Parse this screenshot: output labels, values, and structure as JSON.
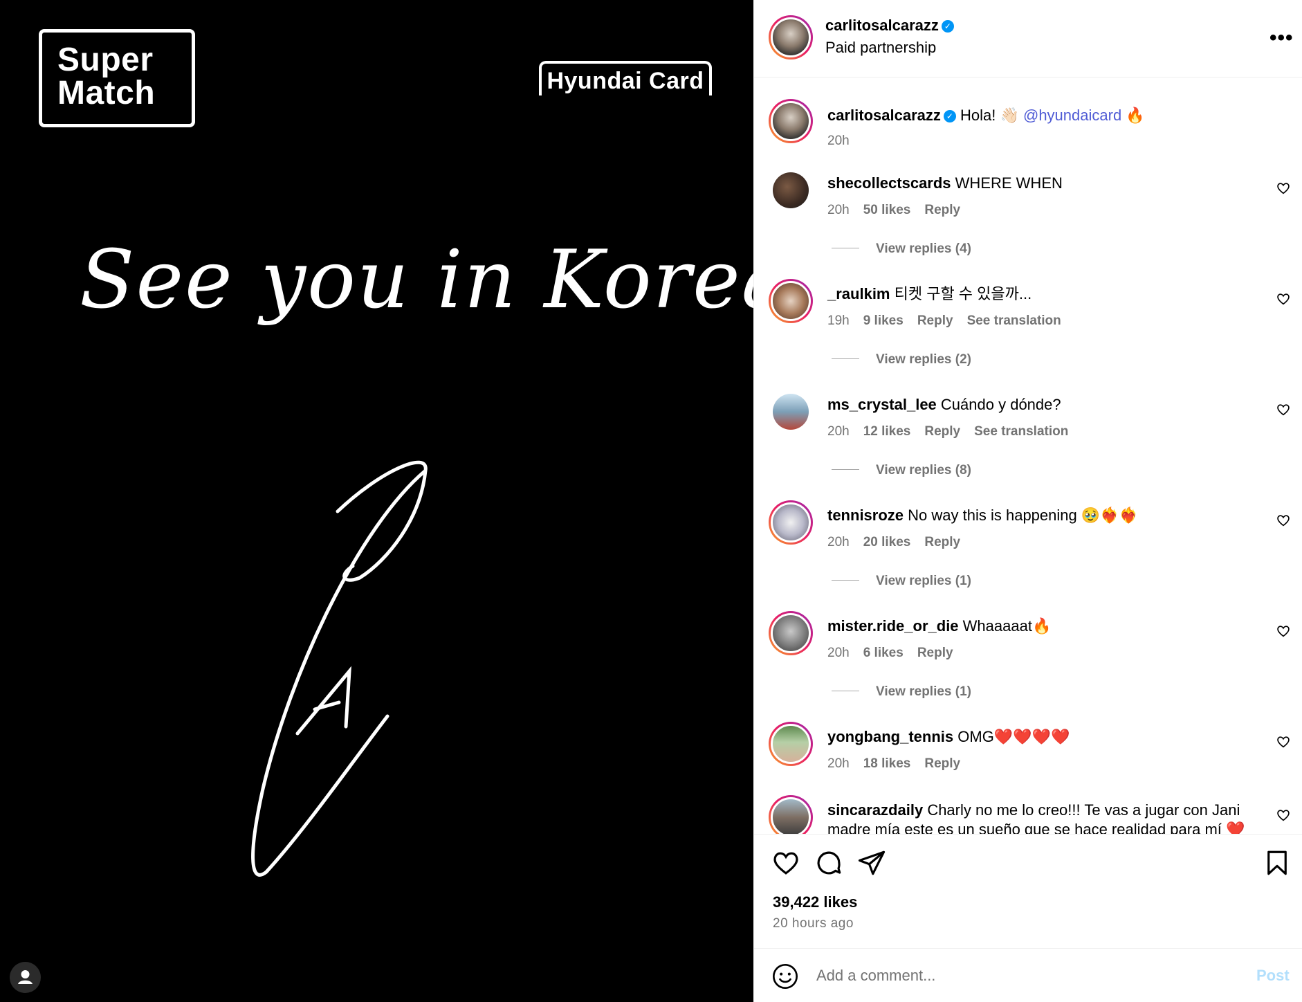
{
  "media": {
    "logo_line1": "Super",
    "logo_line2": "Match",
    "badge": "Hyundai Card",
    "headline": "See you in Korea!"
  },
  "post_header": {
    "username": "carlitosalcarazz",
    "subtitle": "Paid partnership",
    "more": "•••"
  },
  "caption": {
    "username": "carlitosalcarazz",
    "text": "Hola! 👋🏻 ",
    "mention": "@hyundaicard",
    "emoji": " 🔥",
    "time": "20h"
  },
  "comments": [
    {
      "username": "shecollectscards",
      "text": "WHERE WHEN",
      "time": "20h",
      "likes": "50 likes",
      "reply": "Reply",
      "translation": "",
      "replies": "View replies (4)"
    },
    {
      "username": "_raulkim",
      "text": "티켓 구할 수 있을까...",
      "time": "19h",
      "likes": "9 likes",
      "reply": "Reply",
      "translation": "See translation",
      "replies": "View replies (2)"
    },
    {
      "username": "ms_crystal_lee",
      "text": "Cuándo y dónde?",
      "time": "20h",
      "likes": "12 likes",
      "reply": "Reply",
      "translation": "See translation",
      "replies": "View replies (8)"
    },
    {
      "username": "tennisroze",
      "text": "No way this is happening 🥹❤️‍🔥❤️‍🔥",
      "time": "20h",
      "likes": "20 likes",
      "reply": "Reply",
      "translation": "",
      "replies": "View replies (1)"
    },
    {
      "username": "mister.ride_or_die",
      "text": "Whaaaaat🔥",
      "time": "20h",
      "likes": "6 likes",
      "reply": "Reply",
      "translation": "",
      "replies": "View replies (1)"
    },
    {
      "username": "yongbang_tennis",
      "text": "OMG❤️❤️❤️❤️",
      "time": "20h",
      "likes": "18 likes",
      "reply": "Reply",
      "translation": "",
      "replies": ""
    },
    {
      "username": "sincarazdaily",
      "text": "Charly no me lo creo!!! Te vas a jugar con Jani",
      "text2": "madre mía este es un sueño que se hace realidad para mí ❤️",
      "time": "",
      "likes": "",
      "reply": "",
      "translation": "",
      "replies": ""
    }
  ],
  "actions": {
    "likes": "39,422 likes",
    "time_ago": "20 hours ago"
  },
  "comment_box": {
    "placeholder": "Add a comment...",
    "post": "Post"
  },
  "icons": [
    "user-icon",
    "verified-icon",
    "more-icon",
    "heart-icon",
    "comment-icon",
    "share-icon",
    "bookmark-icon",
    "emoji-icon"
  ],
  "colors": {
    "accent": "#0095f6",
    "mention": "#4f5bd5",
    "post_disabled": "#b2dffc",
    "secondary_text": "#737373"
  }
}
